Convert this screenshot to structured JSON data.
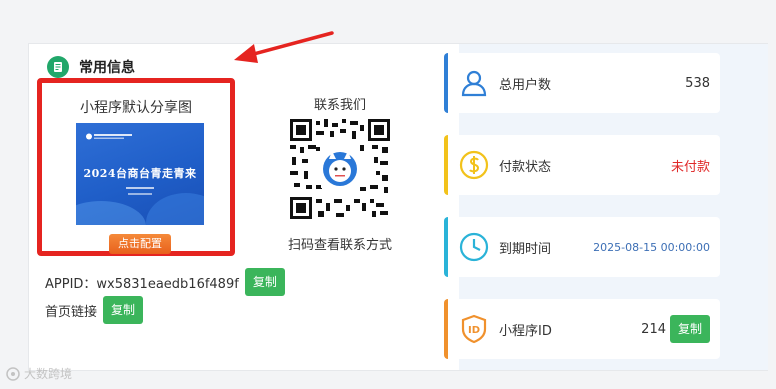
{
  "section_title": "常用信息",
  "share": {
    "label": "小程序默认分享图",
    "image_headline": "2024台商台青走青来",
    "config_button": "点击配置"
  },
  "contact": {
    "label": "联系我们",
    "caption": "扫码查看联系方式"
  },
  "appid": {
    "label": "APPID：wx5831eaedb16f489f",
    "copy_label": "复制"
  },
  "home_link": {
    "label": "首页链接",
    "copy_label": "复制"
  },
  "stats": [
    {
      "label": "总用户数",
      "value": "538",
      "icon": "user-icon",
      "color": "#2f7fd6"
    },
    {
      "label": "付款状态",
      "value": "未付款",
      "icon": "dollar-icon",
      "color": "#f2c21b",
      "value_color": "#e02a2a"
    },
    {
      "label": "到期时间",
      "value": "2025-08-15 00:00:00",
      "icon": "clock-icon",
      "color": "#2ab3d8",
      "value_color": "#3d6fb5"
    },
    {
      "label": "小程序ID",
      "value": "214",
      "icon": "id-shield-icon",
      "color": "#f0912d",
      "copy_label": "复制"
    }
  ],
  "watermark": "大数跨境",
  "colors": {
    "highlight": "#e52420",
    "copy_button": "#3bb55b",
    "config_button": "#e8601c"
  }
}
